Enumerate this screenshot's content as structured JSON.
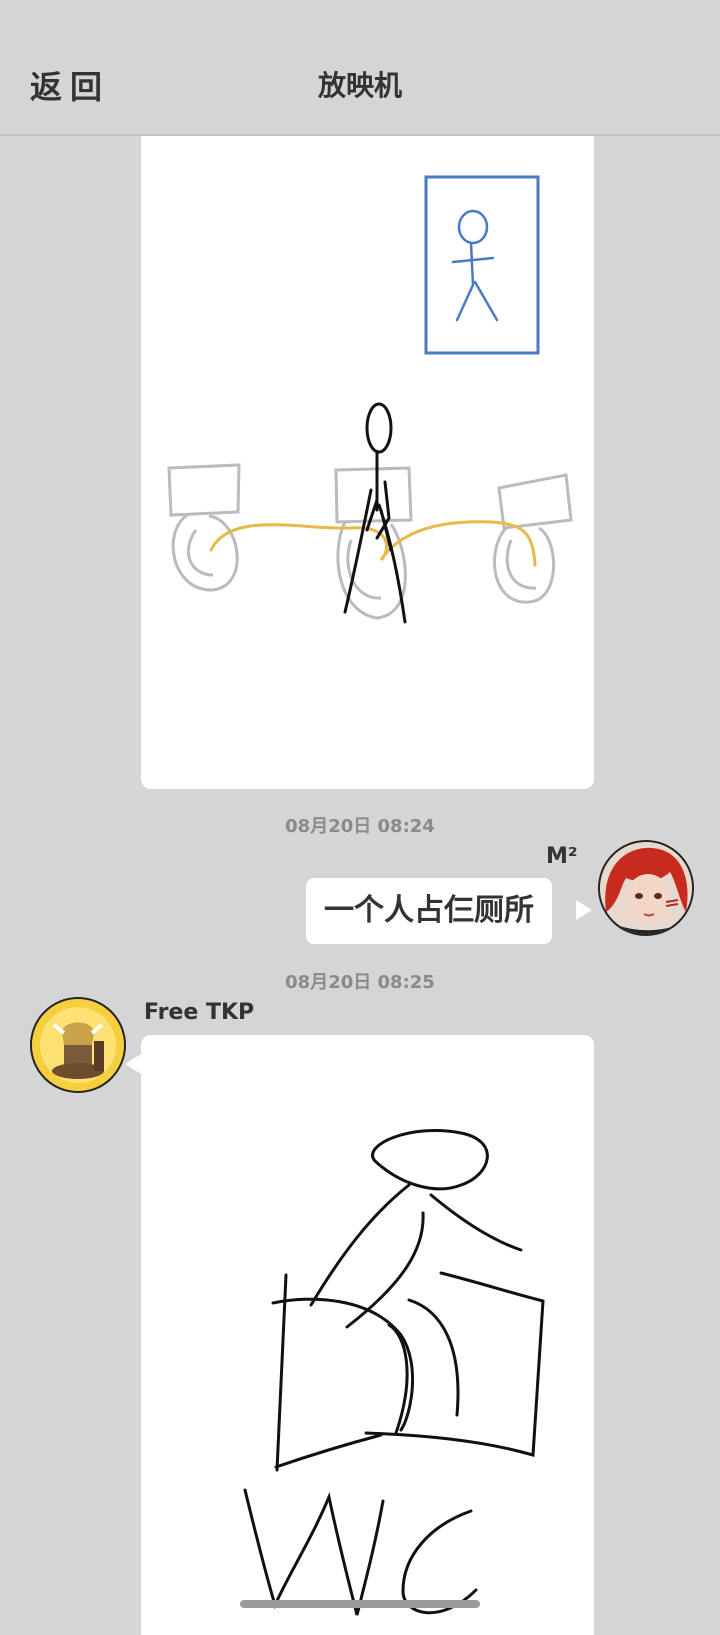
{
  "header": {
    "back_label": "返回",
    "title": "放映机"
  },
  "messages": [
    {
      "timestamp": "08月20日  08:24",
      "sender": "M²",
      "text": "一个人占仨厕所"
    },
    {
      "timestamp": "08月20日  08:25",
      "sender": "Free TKP"
    }
  ],
  "colors": {
    "background": "#d5d5d5",
    "bubble": "#ffffff",
    "sketch_blue": "#4a79c5",
    "sketch_yellow": "#e7b84a"
  }
}
